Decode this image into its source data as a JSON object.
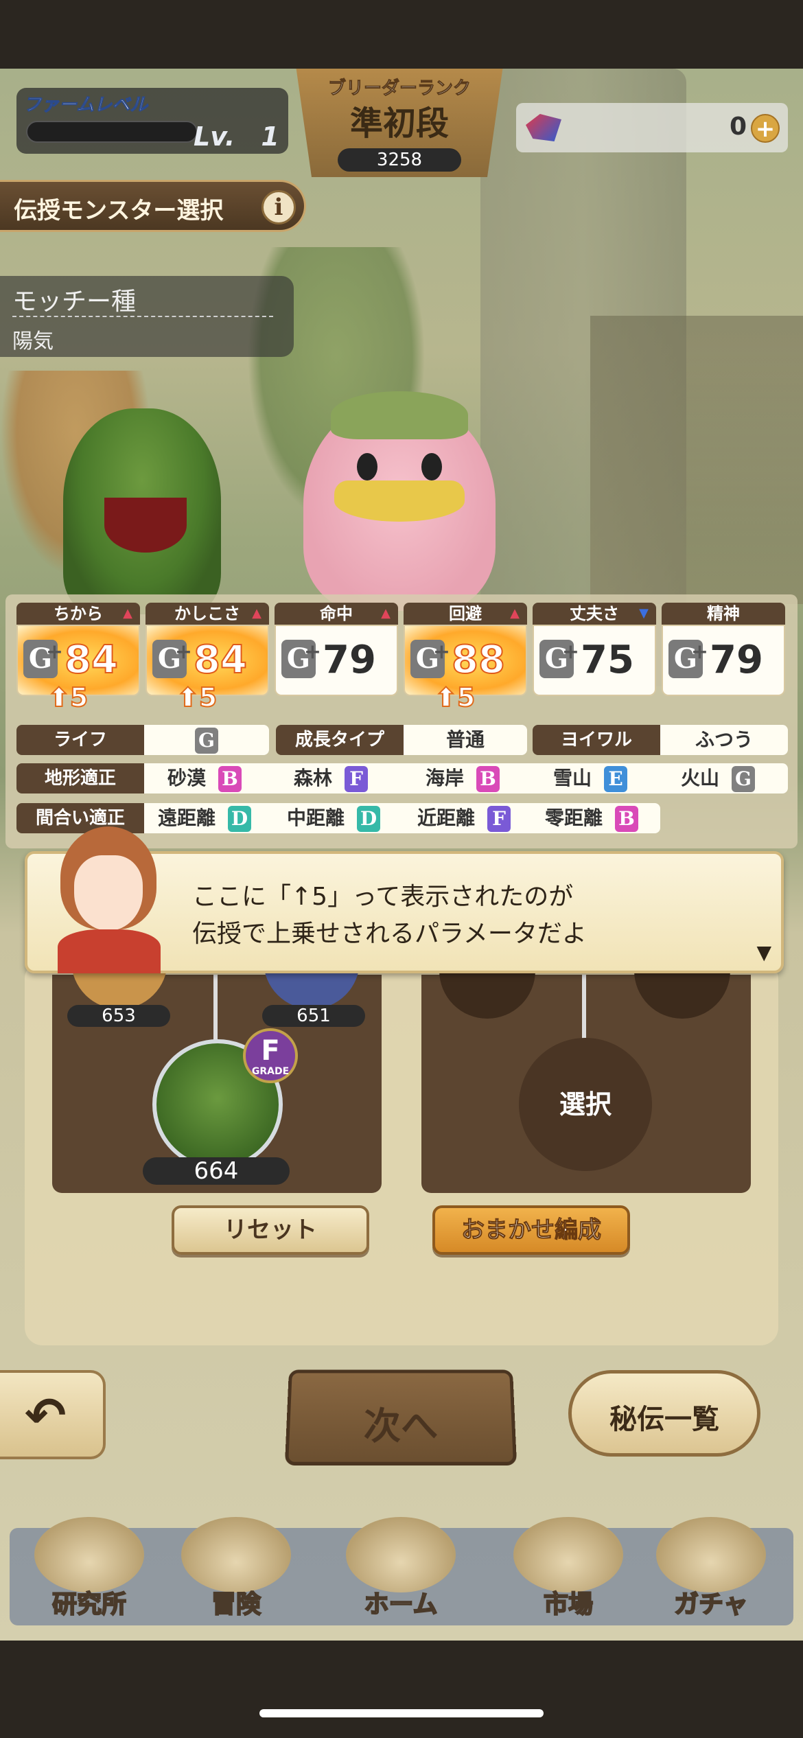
{
  "header": {
    "farm_label": "ファームレベル",
    "farm_level": "Lv.　1",
    "rank_label": "ブリーダーランク",
    "rank_name": "準初段",
    "rank_points": "3258",
    "gem_count": "0",
    "gem_plus": "+"
  },
  "teach": {
    "label": "伝授モンスター選択",
    "info": "i"
  },
  "species": {
    "name": "モッチー種",
    "trait": "陽気"
  },
  "stats": [
    {
      "label": "ちから",
      "grade": "G",
      "value": "84",
      "trend": "up",
      "highlight": true,
      "bonus": "5"
    },
    {
      "label": "かしこさ",
      "grade": "G",
      "value": "84",
      "trend": "up",
      "highlight": true,
      "bonus": "5"
    },
    {
      "label": "命中",
      "grade": "G",
      "value": "79",
      "trend": "up",
      "highlight": false,
      "bonus": ""
    },
    {
      "label": "回避",
      "grade": "G",
      "value": "88",
      "trend": "up",
      "highlight": true,
      "bonus": "5"
    },
    {
      "label": "丈夫さ",
      "grade": "G",
      "value": "75",
      "trend": "down",
      "highlight": false,
      "bonus": ""
    },
    {
      "label": "精神",
      "grade": "G",
      "value": "79",
      "trend": "none",
      "highlight": false,
      "bonus": ""
    }
  ],
  "info_row": {
    "life_label": "ライフ",
    "life_value": "G",
    "growth_label": "成長タイプ",
    "growth_value": "普通",
    "yoiwaru_label": "ヨイワル",
    "yoiwaru_value": "ふつう"
  },
  "terrain": {
    "label": "地形適正",
    "items": [
      {
        "name": "砂漠",
        "grade": "B",
        "color": "#d94ab8"
      },
      {
        "name": "森林",
        "grade": "F",
        "color": "#7a5ad6"
      },
      {
        "name": "海岸",
        "grade": "B",
        "color": "#d94ab8"
      },
      {
        "name": "雪山",
        "grade": "E",
        "color": "#3f8fd9"
      },
      {
        "name": "火山",
        "grade": "G",
        "color": "#808080"
      }
    ]
  },
  "range": {
    "label": "間合い適正",
    "items": [
      {
        "name": "遠距離",
        "grade": "D",
        "color": "#36b9a8"
      },
      {
        "name": "中距離",
        "grade": "D",
        "color": "#36b9a8"
      },
      {
        "name": "近距離",
        "grade": "F",
        "color": "#7a5ad6"
      },
      {
        "name": "零距離",
        "grade": "B",
        "color": "#d94ab8"
      }
    ]
  },
  "dialog": {
    "line1": "ここに「↑5」って表示されたのが",
    "line2": "伝授で上乗せされるパラメータだよ",
    "next": "▼"
  },
  "tree": {
    "node_left": "653",
    "node_right": "651",
    "main_node": "664",
    "grade_badge": "F",
    "grade_badge_label": "GRADE",
    "select": "選択"
  },
  "buttons": {
    "reset": "リセット",
    "auto": "おまかせ編成",
    "back": "↶",
    "next": "次へ",
    "hiden": "秘伝一覧"
  },
  "nav": [
    "研究所",
    "冒険",
    "ホーム",
    "市場",
    "ガチャ"
  ]
}
